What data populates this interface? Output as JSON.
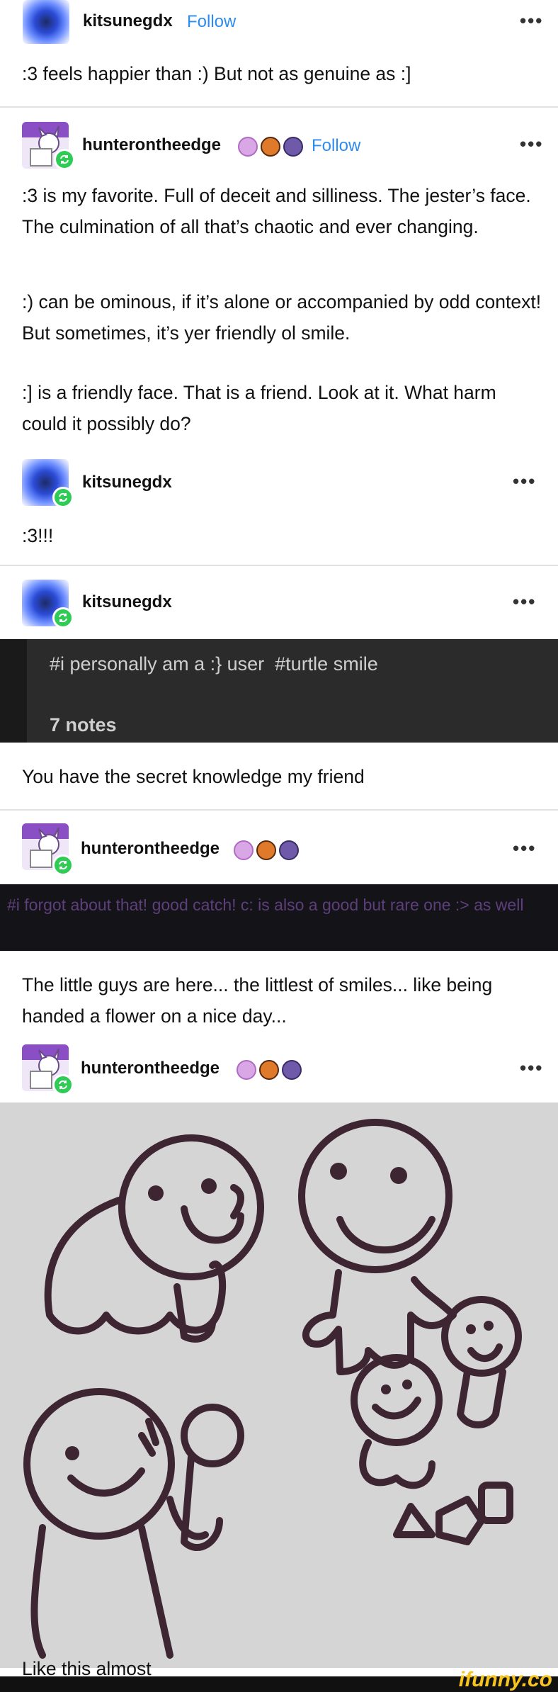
{
  "posts": {
    "p1": {
      "user": "kitsunegdx",
      "follow": "Follow",
      "menu": "•••",
      "text": ":3 feels happier than :) But not as genuine as :]"
    },
    "p2": {
      "user": "hunterontheedge",
      "follow": "Follow",
      "menu": "•••",
      "para1": ":3 is my favorite. Full of deceit and silliness. The jester’s face. The culmination of all that’s chaotic and ever changing.",
      "para2": ":) can be ominous, if it’s alone or accompanied by odd context! But sometimes, it’s yer friendly ol smile.",
      "para3": ":] is a friendly face. That is a friend. Look at it. What harm could it possibly do?"
    },
    "p3": {
      "user": "kitsunegdx",
      "menu": "•••",
      "text": ":3!!!"
    },
    "p4": {
      "user": "kitsunegdx",
      "menu": "•••",
      "tags": "#i personally am a :} user  #turtle smile",
      "notes": "7 notes",
      "text": "You have the secret knowledge my friend"
    },
    "p5": {
      "user": "hunterontheedge",
      "menu": "•••",
      "tags": "#i forgot about that! good catch! c: is also a good but rare one :> as well",
      "text": "The little guys are here... the littlest of smiles... like being handed a flower on a nice day..."
    },
    "p6": {
      "user": "hunterontheedge",
      "menu": "•••",
      "caption": "Like this almost"
    }
  },
  "icons": {
    "reblog": "reblog-icon",
    "badges": [
      "brain-badge",
      "paw-badge",
      "skull-badge"
    ]
  },
  "colors": {
    "follow": "#2d8cf0",
    "reblog": "#2ecc55",
    "drawing_bg": "#d5d5d5",
    "ink": "#3d2531",
    "watermark": "#f7c41f"
  },
  "watermark": "ifunny.co"
}
